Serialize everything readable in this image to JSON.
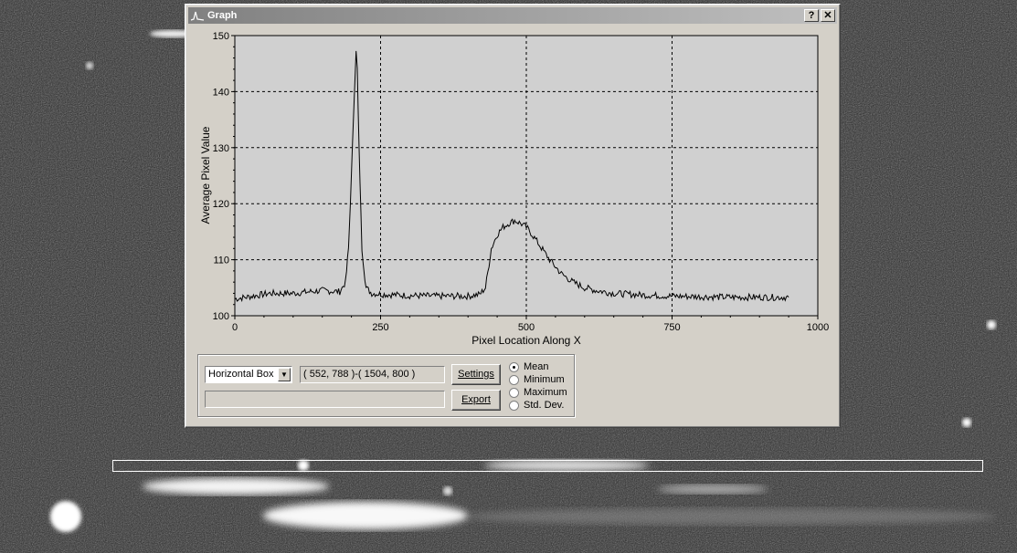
{
  "window": {
    "title": "Graph",
    "help_label": "?",
    "close_label": "✕"
  },
  "chart_data": {
    "type": "line",
    "xlabel": "Pixel Location Along X",
    "ylabel": "Average Pixel Value",
    "xlim": [
      0,
      1000
    ],
    "ylim": [
      100,
      150
    ],
    "xticks": [
      0,
      250,
      500,
      750,
      1000
    ],
    "yticks": [
      100,
      110,
      120,
      130,
      140,
      150
    ],
    "grid": true,
    "background": "#d0d0d0",
    "line_color": "#000000",
    "series": [
      {
        "x": [
          0,
          30,
          60,
          100,
          150,
          180,
          190,
          195,
          200,
          205,
          208,
          210,
          213,
          218,
          225,
          235,
          260,
          300,
          350,
          400,
          420,
          430,
          440,
          450,
          460,
          470,
          480,
          490,
          500,
          510,
          520,
          540,
          560,
          580,
          600,
          620,
          650,
          700,
          750,
          800,
          850,
          900,
          950
        ],
        "y": [
          103,
          103.5,
          104,
          104,
          104.5,
          104.3,
          106,
          112,
          125,
          140,
          147,
          144,
          130,
          112,
          105,
          104,
          103.8,
          103.6,
          103.5,
          103.5,
          103.8,
          105,
          112,
          114.5,
          115.8,
          116.5,
          117,
          116.5,
          115.8,
          114.5,
          113,
          110,
          107.5,
          106,
          105,
          104.5,
          104,
          103.7,
          103.5,
          103.4,
          103.3,
          103.3,
          103.3
        ]
      }
    ]
  },
  "controls": {
    "mode_value": "Horizontal Box",
    "coords_text": "( 552, 788 )-( 1504, 800 )",
    "status_text": "",
    "settings_label": "Settings",
    "export_label": "Export",
    "statistic_options": [
      "Mean",
      "Minimum",
      "Maximum",
      "Std. Dev."
    ],
    "selected_statistic": "Mean"
  }
}
